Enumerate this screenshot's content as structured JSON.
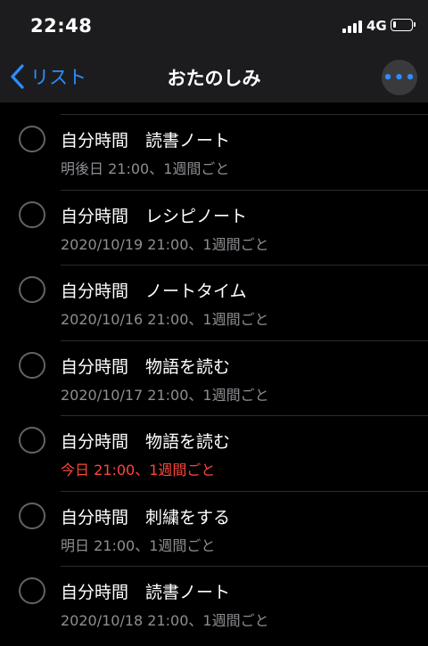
{
  "status_bar": {
    "time": "22:48",
    "network": "4G",
    "signal_bars": 4,
    "battery_level": 0.15
  },
  "nav": {
    "back_label": "リスト",
    "title": "おたのしみ",
    "more_icon": "•••"
  },
  "colors": {
    "accent": "#2f8cff",
    "overdue": "#ff453a",
    "secondary_text": "#8e8e93"
  },
  "reminders": [
    {
      "title": "自分時間　読書ノート",
      "subtitle": "明後日 21:00、1週間ごと",
      "overdue": false
    },
    {
      "title": "自分時間　レシピノート",
      "subtitle": "2020/10/19 21:00、1週間ごと",
      "overdue": false
    },
    {
      "title": "自分時間　ノートタイム",
      "subtitle": "2020/10/16 21:00、1週間ごと",
      "overdue": false
    },
    {
      "title": "自分時間　物語を読む",
      "subtitle": "2020/10/17 21:00、1週間ごと",
      "overdue": false
    },
    {
      "title": "自分時間　物語を読む",
      "subtitle": "今日 21:00、1週間ごと",
      "overdue": true
    },
    {
      "title": "自分時間　刺繍をする",
      "subtitle": "明日 21:00、1週間ごと",
      "overdue": false
    },
    {
      "title": "自分時間　読書ノート",
      "subtitle": "2020/10/18 21:00、1週間ごと",
      "overdue": false
    }
  ]
}
